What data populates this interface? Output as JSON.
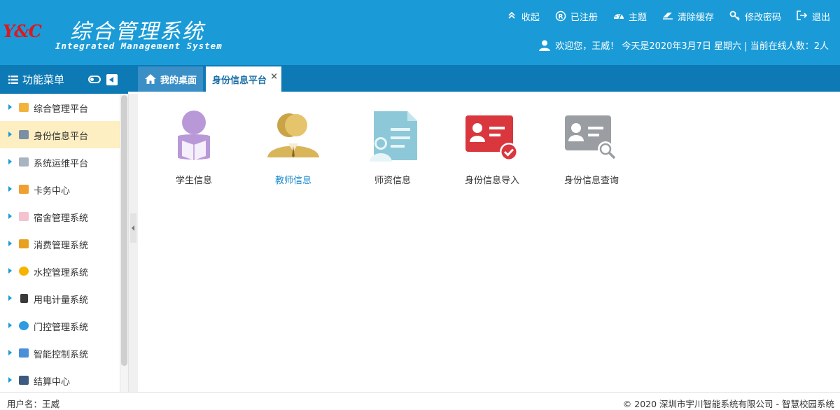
{
  "header": {
    "logo_mark": "Y&C",
    "title": "综合管理系统",
    "subtitle": "Integrated Management System",
    "actions": [
      {
        "label": "收起",
        "icon": "double-chevron-up-icon"
      },
      {
        "label": "已注册",
        "icon": "registered-icon"
      },
      {
        "label": "主题",
        "icon": "dashboard-icon"
      },
      {
        "label": "清除缓存",
        "icon": "eraser-icon"
      },
      {
        "label": "修改密码",
        "icon": "key-icon"
      },
      {
        "label": "退出",
        "icon": "logout-icon"
      }
    ],
    "welcome": "欢迎您，王威！ 今天是2020年3月7日 星期六 | 当前在线人数：2人"
  },
  "sidebar": {
    "title": "功能菜单",
    "items": [
      {
        "label": "综合管理平台",
        "icon": "folder-icon",
        "color": "#f2b33d"
      },
      {
        "label": "身份信息平台",
        "icon": "id-card-icon",
        "color": "#7a8fa6"
      },
      {
        "label": "系统运维平台",
        "icon": "gear-icon",
        "color": "#a8b4c0"
      },
      {
        "label": "卡务中心",
        "icon": "card-icon",
        "color": "#f0a030"
      },
      {
        "label": "宿舍管理系统",
        "icon": "dorm-icon",
        "color": "#f5c2d0"
      },
      {
        "label": "消费管理系统",
        "icon": "wallet-icon",
        "color": "#e8a020"
      },
      {
        "label": "水控管理系统",
        "icon": "water-icon",
        "color": "#f6b400"
      },
      {
        "label": "用电计量系统",
        "icon": "meter-icon",
        "color": "#3a3a3a"
      },
      {
        "label": "门控管理系统",
        "icon": "door-icon",
        "color": "#2f9be0"
      },
      {
        "label": "智能控制系统",
        "icon": "control-icon",
        "color": "#4a90d9"
      },
      {
        "label": "结算中心",
        "icon": "calculator-icon",
        "color": "#3d5a80"
      }
    ],
    "active_index": 1
  },
  "tabs": [
    {
      "label": "我的桌面",
      "icon": "home-icon"
    },
    {
      "label": "身份信息平台",
      "close": "×"
    }
  ],
  "apps": [
    {
      "label": "学生信息",
      "icon": "student-icon",
      "color": "#b998d8"
    },
    {
      "label": "教师信息",
      "icon": "teacher-icon",
      "color": "#d9b55a"
    },
    {
      "label": "师资信息",
      "icon": "faculty-document-icon",
      "color": "#8cc8d8"
    },
    {
      "label": "身份信息导入",
      "icon": "id-import-icon",
      "color": "#d9363e"
    },
    {
      "label": "身份信息查询",
      "icon": "id-search-icon",
      "color": "#9a9ea3"
    }
  ],
  "footer": {
    "user": "用户名：王威",
    "copyright": "© 2020 深圳市宇川智能系统有限公司 - 智慧校园系统"
  }
}
